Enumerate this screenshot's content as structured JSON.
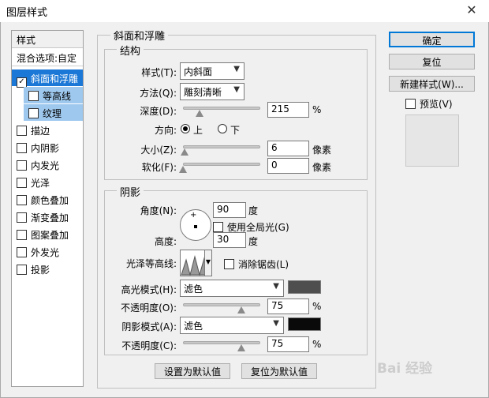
{
  "window": {
    "title": "图层样式",
    "close_glyph": "✕"
  },
  "styles_panel": {
    "header": "样式",
    "blend_options": "混合选项:自定",
    "items": [
      {
        "label": "斜面和浮雕",
        "checked": true,
        "selected": true
      },
      {
        "label": "等高线",
        "checked": false,
        "sub": true
      },
      {
        "label": "纹理",
        "checked": false,
        "sub": true
      },
      {
        "label": "描边",
        "checked": false
      },
      {
        "label": "内阴影",
        "checked": false
      },
      {
        "label": "内发光",
        "checked": false
      },
      {
        "label": "光泽",
        "checked": false
      },
      {
        "label": "颜色叠加",
        "checked": false
      },
      {
        "label": "渐变叠加",
        "checked": false
      },
      {
        "label": "图案叠加",
        "checked": false
      },
      {
        "label": "外发光",
        "checked": false
      },
      {
        "label": "投影",
        "checked": false
      }
    ]
  },
  "bevel": {
    "section_title": "斜面和浮雕",
    "structure": {
      "title": "结构",
      "style_label": "样式(T):",
      "style_value": "内斜面",
      "technique_label": "方法(Q):",
      "technique_value": "雕刻清晰",
      "depth_label": "深度(D):",
      "depth_value": "215",
      "depth_unit": "%",
      "depth_level": 0.21,
      "direction_label": "方向:",
      "direction_up": "上",
      "direction_down": "下",
      "direction_selected": "上",
      "size_label": "大小(Z):",
      "size_value": "6",
      "size_unit": "像素",
      "size_level": 0.02,
      "soften_label": "软化(F):",
      "soften_value": "0",
      "soften_unit": "像素",
      "soften_level": 0.0
    },
    "shading": {
      "title": "阴影",
      "angle_label": "角度(N):",
      "angle_value": "90",
      "angle_unit": "度",
      "global_light_label": "使用全局光(G)",
      "global_light_checked": false,
      "altitude_label": "高度:",
      "altitude_value": "30",
      "altitude_unit": "度",
      "gloss_contour_label": "光泽等高线:",
      "antialias_label": "消除锯齿(L)",
      "antialias_checked": false,
      "highlight_mode_label": "高光模式(H):",
      "highlight_mode_value": "滤色",
      "highlight_color": "#4e4e4e",
      "highlight_opacity_label": "不透明度(O):",
      "highlight_opacity_value": "75",
      "highlight_opacity_unit": "%",
      "highlight_opacity_level": 0.75,
      "shadow_mode_label": "阴影模式(A):",
      "shadow_mode_value": "滤色",
      "shadow_color": "#0a0a0a",
      "shadow_opacity_label": "不透明度(C):",
      "shadow_opacity_value": "75",
      "shadow_opacity_unit": "%",
      "shadow_opacity_level": 0.75
    },
    "make_default_label": "设置为默认值",
    "reset_default_label": "复位为默认值"
  },
  "buttons": {
    "ok": "确定",
    "reset": "复位",
    "new_style": "新建样式(W)...",
    "preview_label": "预览(V)",
    "preview_checked": false
  },
  "watermark": "Bai 经验"
}
